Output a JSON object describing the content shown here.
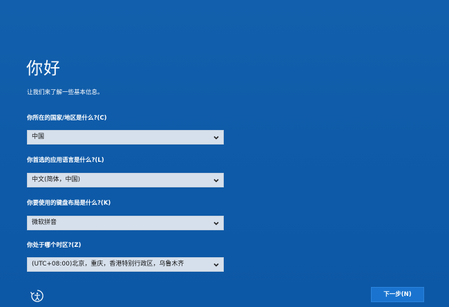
{
  "header": {
    "title": "你好",
    "subtitle": "让我们来了解一些基本信息。"
  },
  "fields": [
    {
      "label": "你所在的国家/地区是什么?(C)",
      "value": "中国"
    },
    {
      "label": "你首选的应用语言是什么?(L)",
      "value": "中文(简体，中国)"
    },
    {
      "label": "你要使用的键盘布局是什么?(K)",
      "value": "微软拼音"
    },
    {
      "label": "你处于哪个时区?(Z)",
      "value": "(UTC+08:00)北京，重庆，香港特别行政区，乌鲁木齐"
    }
  ],
  "footer": {
    "accessibility_icon": "ease-of-access-icon",
    "next_label": "下一步(N)"
  },
  "colors": {
    "background": "#0f5ba9",
    "select_background": "#d6e0ec",
    "button_background": "#1a74cf"
  },
  "icons": {
    "dropdown": "chevron-down-icon"
  }
}
